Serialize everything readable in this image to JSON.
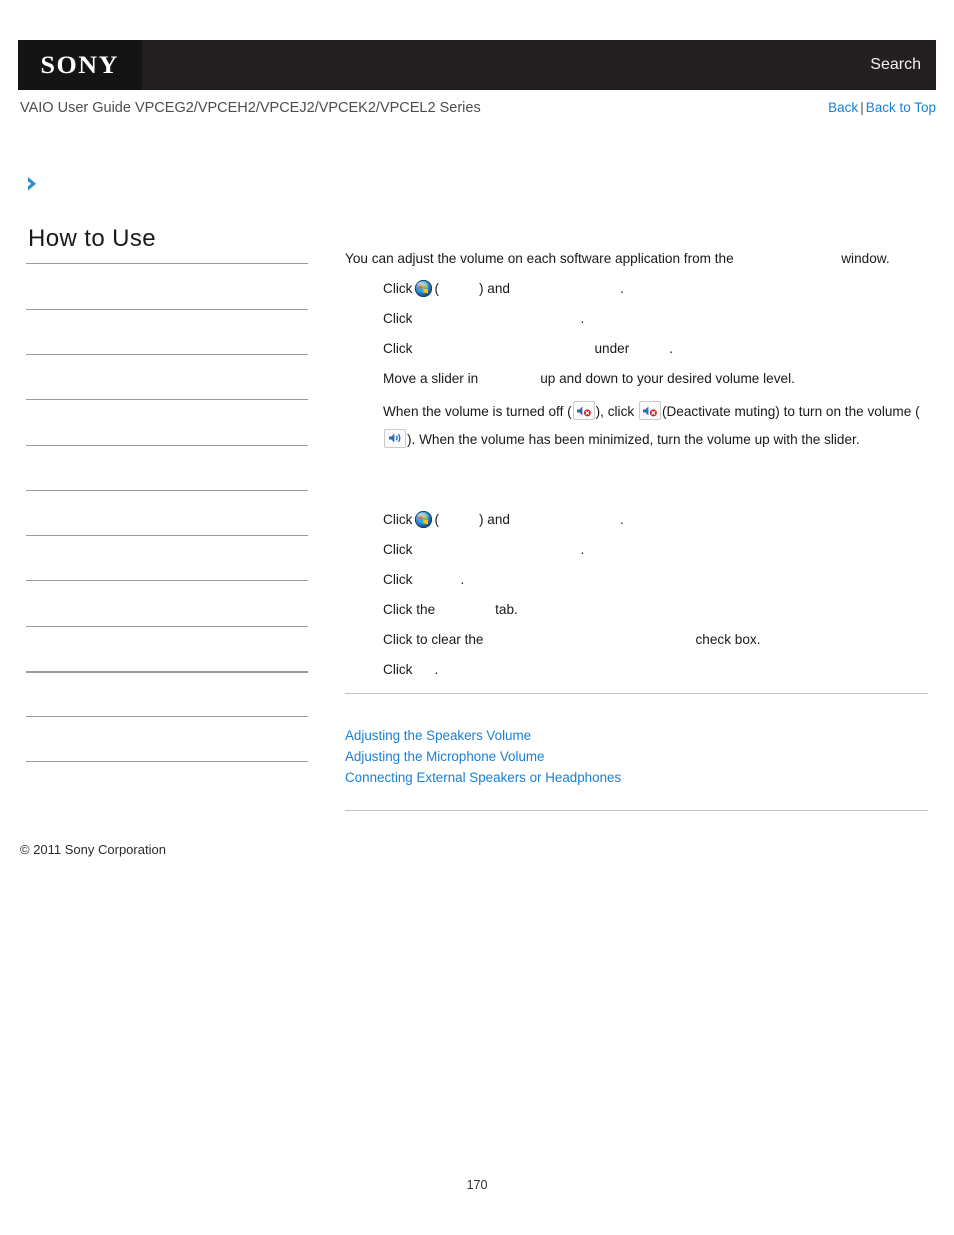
{
  "header": {
    "logo_text": "SONY",
    "search_label": "Search",
    "guide_title": "VAIO User Guide VPCEG2/VPCEH2/VPCEJ2/VPCEK2/VPCEL2 Series",
    "back_label": "Back",
    "separator": "|",
    "back_to_top_label": "Back to Top"
  },
  "sidebar": {
    "title": "How to Use",
    "items": [
      {
        "label": ""
      },
      {
        "label": ""
      },
      {
        "label": ""
      },
      {
        "label": ""
      },
      {
        "label": ""
      },
      {
        "label": ""
      },
      {
        "label": ""
      },
      {
        "label": ""
      },
      {
        "label": ""
      },
      {
        "label": ""
      },
      {
        "label": ""
      }
    ]
  },
  "content": {
    "intro_before": "You can adjust the volume on each software application from the",
    "intro_term": "",
    "intro_after": "window.",
    "steps_a": [
      {
        "pre": "Click",
        "icon": "windows-start-orb",
        "mid_open": "(",
        "term": "",
        "mid_close": ") and",
        "term2": "",
        "post": "."
      },
      {
        "pre": "Click",
        "term": "",
        "post": "."
      },
      {
        "pre": "Click",
        "term": "",
        "mid": "under",
        "term2": "",
        "post": "."
      },
      {
        "pre": "Move a slider in",
        "term": "",
        "post": "up and down to your desired volume level."
      },
      {
        "pre": "When the volume is turned off (",
        "icon1": "volume-muted-icon",
        "mid1": "), click",
        "icon2": "volume-muted-icon",
        "mid2": "(Deactivate muting) to turn on the volume (",
        "icon3": "volume-on-icon",
        "post": "). When the volume has been minimized, turn the volume up with the slider."
      }
    ],
    "steps_b": [
      {
        "pre": "Click",
        "icon": "windows-start-orb",
        "mid_open": "(",
        "term": "",
        "mid_close": ") and",
        "term2": "",
        "post": "."
      },
      {
        "pre": "Click",
        "term": "",
        "post": "."
      },
      {
        "pre": "Click",
        "term": "",
        "post": "."
      },
      {
        "pre": "Click the",
        "term": "",
        "post": "tab."
      },
      {
        "pre": "Click to clear the",
        "term": "",
        "post": "check box."
      },
      {
        "pre": "Click",
        "term": "",
        "post": "."
      }
    ]
  },
  "related": {
    "links": [
      "Adjusting the Speakers Volume",
      "Adjusting the Microphone Volume",
      "Connecting External Speakers or Headphones"
    ]
  },
  "footer": {
    "copyright": "© 2011 Sony Corporation",
    "page_number": "170"
  },
  "colors": {
    "link_blue": "#1a7fd4",
    "header_black": "#231f20",
    "logo_black": "#141414",
    "rule_gray": "#9b9b9b",
    "chevron_blue": "#2d8fd0"
  }
}
